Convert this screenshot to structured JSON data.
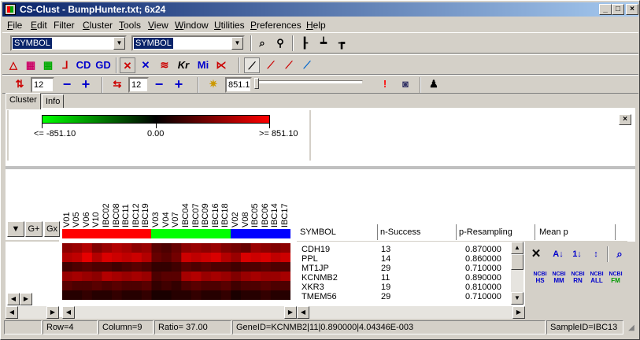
{
  "window": {
    "title": "CS-Clust - BumpHunter.txt; 6x24"
  },
  "menu": [
    {
      "label": "File",
      "u": "F",
      "rest": "ile"
    },
    {
      "label": "Edit",
      "u": "E",
      "rest": "dit"
    },
    {
      "label": "Filter",
      "u": "",
      "rest": "Filter"
    },
    {
      "label": "Cluster",
      "u": "C",
      "rest": "luster"
    },
    {
      "label": "Tools",
      "u": "T",
      "rest": "ools"
    },
    {
      "label": "View",
      "u": "V",
      "rest": "iew"
    },
    {
      "label": "Window",
      "u": "W",
      "rest": "indow"
    },
    {
      "label": "Utilities",
      "u": "U",
      "rest": "tilities"
    },
    {
      "label": "Preferences",
      "u": "P",
      "rest": "references"
    },
    {
      "label": "Help",
      "u": "H",
      "rest": "elp"
    }
  ],
  "toolbar1": {
    "combo1": "SYMBOL",
    "combo2": "SYMBOL"
  },
  "toolbar2": {
    "cd": "CD",
    "gd": "GD",
    "kr": "Kr",
    "mi": "Mi"
  },
  "toolbar3": {
    "spin1": "12",
    "spin2": "12",
    "spin3": "851.1",
    "minus": "−",
    "plus": "+"
  },
  "tabs": [
    {
      "label": "Cluster"
    },
    {
      "label": "Info"
    }
  ],
  "legend": {
    "min": "<= -851.10",
    "mid": "0.00",
    "max": ">= 851.10"
  },
  "side_buttons": {
    "gplus": "G+",
    "gx": "Gx"
  },
  "columns": [
    "V01",
    "V05",
    "V06",
    "V10",
    "IBC02",
    "IBC08",
    "IBC11",
    "IBC12",
    "IBC19",
    "V03",
    "V04",
    "V07",
    "IBC04",
    "IBC07",
    "IBC09",
    "IBC16",
    "IBC18",
    "V02",
    "V08",
    "IBC05",
    "IBC06",
    "IBC14",
    "IBC17"
  ],
  "column_groups": [
    {
      "color": "#ff0000",
      "count": 9
    },
    {
      "color": "#00ff00",
      "count": 8
    },
    {
      "color": "#0000ff",
      "count": 6
    }
  ],
  "heatmap_rows": [
    [
      0.55,
      0.6,
      0.7,
      0.5,
      0.6,
      0.7,
      0.65,
      0.55,
      0.6,
      0.35,
      0.3,
      0.4,
      0.55,
      0.6,
      0.55,
      0.6,
      0.5,
      0.45,
      0.4,
      0.6,
      0.55,
      0.5,
      0.55
    ],
    [
      0.7,
      0.75,
      0.9,
      0.7,
      0.85,
      0.8,
      0.75,
      0.8,
      0.7,
      0.4,
      0.35,
      0.45,
      0.8,
      0.75,
      0.8,
      0.85,
      0.7,
      0.6,
      0.85,
      0.8,
      0.85,
      0.75,
      0.8
    ],
    [
      0.25,
      0.3,
      0.35,
      0.3,
      0.3,
      0.25,
      0.3,
      0.35,
      0.3,
      0.2,
      0.2,
      0.25,
      0.35,
      0.3,
      0.35,
      0.3,
      0.3,
      0.25,
      0.3,
      0.3,
      0.35,
      0.3,
      0.3
    ],
    [
      0.6,
      0.65,
      0.6,
      0.55,
      0.7,
      0.65,
      0.6,
      0.65,
      0.6,
      0.3,
      0.35,
      0.35,
      0.65,
      0.7,
      0.6,
      0.65,
      0.6,
      0.5,
      0.6,
      0.65,
      0.6,
      0.6,
      0.65
    ],
    [
      0.35,
      0.3,
      0.3,
      0.35,
      0.3,
      0.35,
      0.3,
      0.3,
      0.35,
      0.2,
      0.25,
      0.2,
      0.3,
      0.35,
      0.3,
      0.3,
      0.35,
      0.25,
      0.3,
      0.3,
      0.35,
      0.3,
      0.3
    ],
    [
      0.15,
      0.15,
      0.2,
      0.15,
      0.15,
      0.2,
      0.15,
      0.15,
      0.2,
      0.1,
      0.1,
      0.15,
      0.15,
      0.2,
      0.15,
      0.15,
      0.2,
      0.1,
      0.15,
      0.15,
      0.2,
      0.15,
      0.15
    ]
  ],
  "table": {
    "headers": [
      "SYMBOL",
      "n-Success",
      "p-Resampling",
      "Mean p"
    ],
    "rows": [
      {
        "symbol": "CDH19",
        "n": "13",
        "p": "0.870000"
      },
      {
        "symbol": "PPL",
        "n": "14",
        "p": "0.860000"
      },
      {
        "symbol": "MT1JP",
        "n": "29",
        "p": "0.710000"
      },
      {
        "symbol": "KCNMB2",
        "n": "11",
        "p": "0.890000"
      },
      {
        "symbol": "XKR3",
        "n": "19",
        "p": "0.810000"
      },
      {
        "symbol": "TMEM56",
        "n": "29",
        "p": "0.710000"
      }
    ]
  },
  "ncbi": [
    {
      "top": "NCBI",
      "bottom": "HS"
    },
    {
      "top": "NCBI",
      "bottom": "MM"
    },
    {
      "top": "NCBI",
      "bottom": "RN"
    },
    {
      "top": "NCBI",
      "bottom": "ALL"
    },
    {
      "top": "NCBI",
      "bottom": "FM"
    }
  ],
  "status": {
    "row": "Row=4",
    "column": "Column=9",
    "ratio": "Ratio= 37.00",
    "gene": "GeneID=KCNMB2|11|0.890000|4.04346E-003",
    "sample": "SampleID=IBC13"
  },
  "colors": {
    "accent": "#0a246a",
    "low": "#00ff00",
    "high": "#ff0000"
  }
}
